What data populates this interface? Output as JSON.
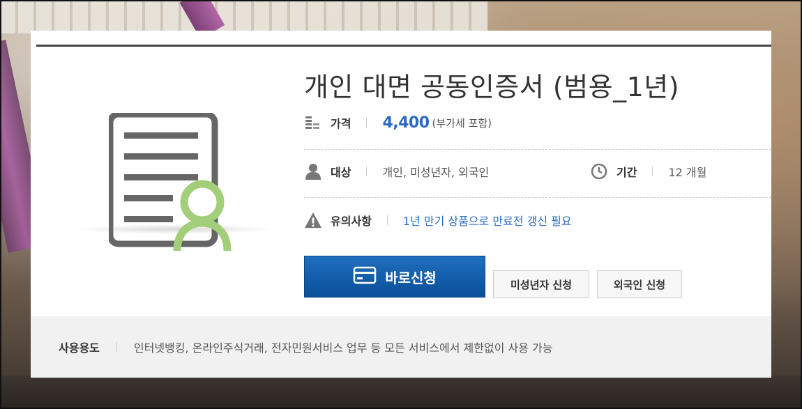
{
  "product": {
    "title": "개인 대면 공동인증서 (범용_1년)"
  },
  "price": {
    "icon": "coins-icon",
    "label": "가격",
    "value": "4,400",
    "note": "(부가세 포함)"
  },
  "target": {
    "icon": "person-icon",
    "label": "대상",
    "value": "개인, 미성년자, 외국인"
  },
  "period": {
    "icon": "clock-icon",
    "label": "기간",
    "value": "12 개월"
  },
  "notice": {
    "icon": "warning-icon",
    "label": "유의사항",
    "value": "1년 만기 상품으로 만료전 갱신 필요"
  },
  "buttons": {
    "apply_now": "바로신청",
    "minor_apply": "미성년자 신청",
    "foreigner_apply": "외국인 신청"
  },
  "usage": {
    "label": "사용용도",
    "value": "인터넷뱅킹, 온라인주식거래, 전자민원서비스 업무 등 모든 서비스에서 제한없이 사용 가능"
  },
  "colors": {
    "accent_blue": "#2a6bc1",
    "button_blue": "#0b4f98",
    "cert_icon_gray": "#666666",
    "cert_icon_green": "#a3cf7a"
  }
}
